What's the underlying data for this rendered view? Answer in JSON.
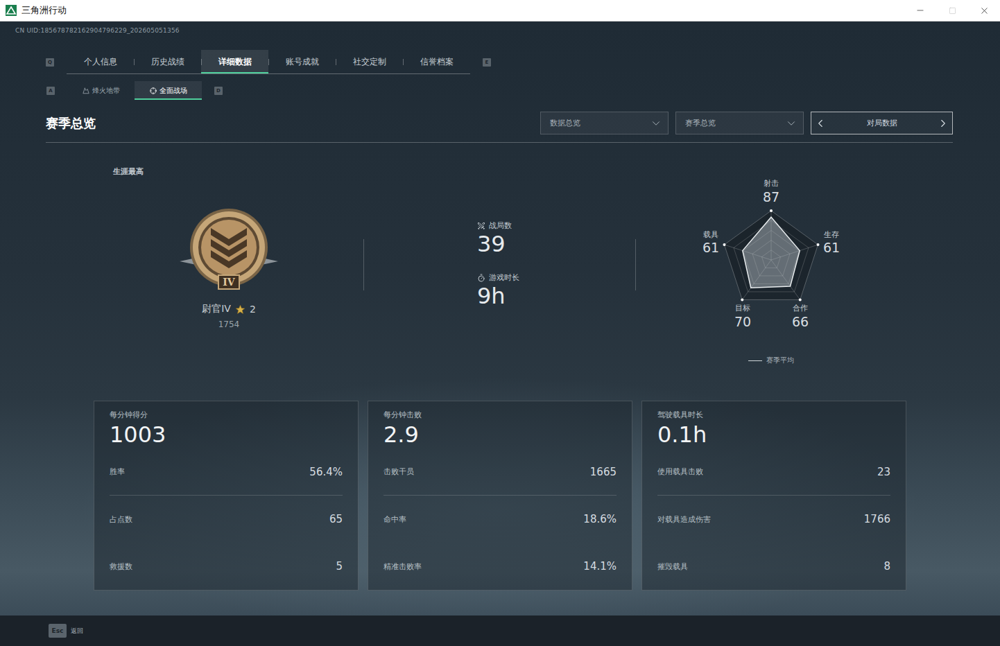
{
  "window": {
    "title": "三角洲行动"
  },
  "uid": "CN UID:185678782162904796229_202605051356",
  "tabs": {
    "prev_key": "Q",
    "next_key": "E",
    "items": [
      {
        "label": "个人信息",
        "selected": false
      },
      {
        "label": "历史战绩",
        "selected": false
      },
      {
        "label": "详细数据",
        "selected": true
      },
      {
        "label": "账号成就",
        "selected": false
      },
      {
        "label": "社交定制",
        "selected": false
      },
      {
        "label": "信誉档案",
        "selected": false
      }
    ]
  },
  "subtabs": {
    "prev_key": "A",
    "next_key": "D",
    "items": [
      {
        "label": "烽火地带",
        "selected": false
      },
      {
        "label": "全面战场",
        "selected": true
      }
    ]
  },
  "section": {
    "title": "赛季总览"
  },
  "filters": [
    {
      "label": "数据总览",
      "kind": "dropdown"
    },
    {
      "label": "赛季总览",
      "kind": "dropdown"
    },
    {
      "label": "对局数据",
      "kind": "pager"
    }
  ],
  "career": {
    "label": "生涯最高",
    "numeral": "IV",
    "rank": "尉官IV",
    "star_count": "2",
    "score": "1754"
  },
  "stats": [
    {
      "label": "战局数",
      "value": "39"
    },
    {
      "label": "游戏时长",
      "value": "9h"
    }
  ],
  "radar": {
    "axes": [
      {
        "label": "射击",
        "value": "87"
      },
      {
        "label": "生存",
        "value": "61"
      },
      {
        "label": "合作",
        "value": "66"
      },
      {
        "label": "目标",
        "value": "70"
      },
      {
        "label": "载具",
        "value": "61"
      }
    ],
    "values": [
      87,
      61,
      66,
      70,
      61
    ],
    "legend": "赛季平均"
  },
  "cards": [
    {
      "title": "每分钟得分",
      "value": "1003",
      "rows": [
        {
          "label": "胜率",
          "value": "56.4%"
        },
        {
          "label": "占点数",
          "value": "65"
        },
        {
          "label": "救援数",
          "value": "5"
        }
      ]
    },
    {
      "title": "每分钟击败",
      "value": "2.9",
      "rows": [
        {
          "label": "击败干员",
          "value": "1665"
        },
        {
          "label": "命中率",
          "value": "18.6%"
        },
        {
          "label": "精准击败率",
          "value": "14.1%"
        }
      ]
    },
    {
      "title": "驾驶载具时长",
      "value": "0.1h",
      "rows": [
        {
          "label": "使用载具击败",
          "value": "23"
        },
        {
          "label": "对载具造成伤害",
          "value": "1766"
        },
        {
          "label": "摧毁载具",
          "value": "8"
        }
      ]
    }
  ],
  "footer": {
    "key": "Esc",
    "label": "返回"
  }
}
